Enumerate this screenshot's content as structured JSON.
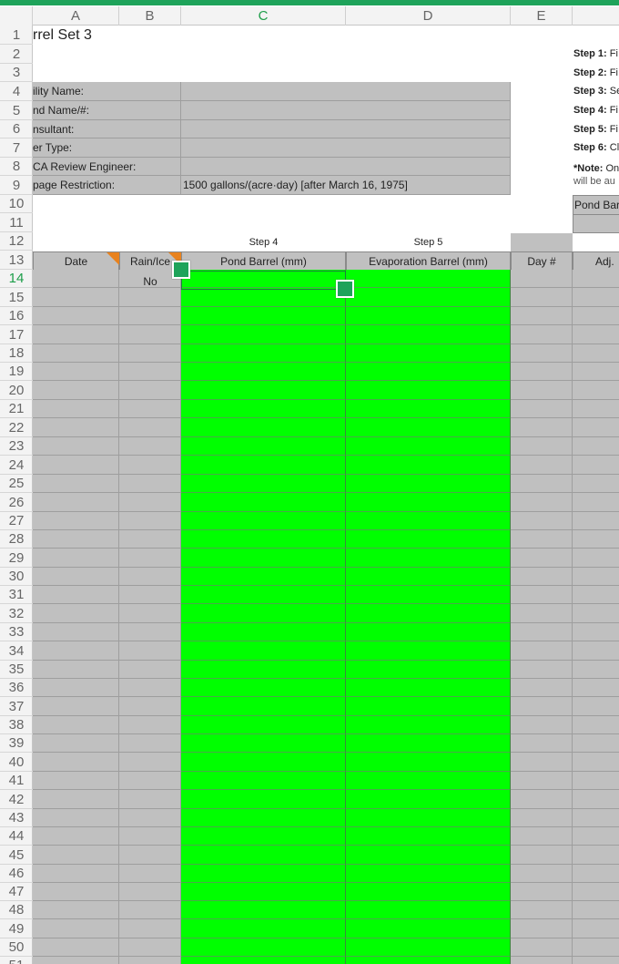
{
  "columns": [
    "A",
    "B",
    "C",
    "D",
    "E"
  ],
  "selected_column": "C",
  "rows": [
    1,
    2,
    3,
    4,
    5,
    6,
    7,
    8,
    9,
    10,
    11,
    12,
    13,
    14,
    15,
    16,
    17,
    18,
    19,
    20,
    21,
    22,
    23,
    24,
    25,
    26,
    27,
    28,
    29,
    30,
    31,
    32,
    33,
    34,
    35,
    36,
    37,
    38,
    39,
    40,
    41,
    42,
    43,
    44,
    45,
    46,
    47,
    48,
    49,
    50,
    51
  ],
  "selected_row": 14,
  "sheet": {
    "title": "rrel Set 3",
    "info_labels": [
      "ility Name:",
      "nd Name/#:",
      "nsultant:",
      "er Type:",
      "CA Review Engineer:",
      "page Restriction:"
    ],
    "seepage_value": "1500 gallons/(acre·day) [after March 16, 1975]",
    "step4": "Step 4",
    "step5": "Step 5",
    "table_headers": {
      "date": "Date",
      "rain": "Rain/Ice",
      "pond": "Pond Barrel (mm)",
      "evap": "Evaporation Barrel (mm)",
      "day": "Day #",
      "adj": "Adj."
    },
    "row14_rain": "No",
    "steps": [
      {
        "label": "Step 1:",
        "text": " Fi"
      },
      {
        "label": "Step 2:",
        "text": " Fi"
      },
      {
        "label": "Step 3:",
        "text": " Se"
      },
      {
        "label": "Step 4:",
        "text": " Fi"
      },
      {
        "label": "Step 5:",
        "text": " Fi"
      },
      {
        "label": "Step 6:",
        "text": " Cl"
      }
    ],
    "note_label": "*Note:",
    "note_text": " On",
    "note_line2": "will be au",
    "pond_bar": "Pond Bar"
  },
  "colors": {
    "accent": "#1ea35a",
    "input_green": "#00ff00",
    "cell_gray": "#c0c0c0",
    "comment_marker": "#e8821e"
  }
}
